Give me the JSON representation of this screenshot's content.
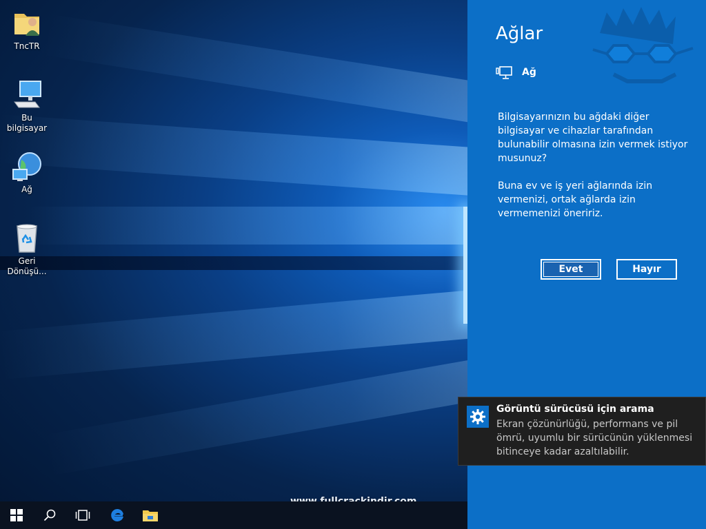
{
  "desktop": {
    "icons": [
      {
        "label": "TncTR",
        "icon": "user-folder-icon"
      },
      {
        "label": "Bu bilgisayar",
        "icon": "computer-icon"
      },
      {
        "label": "Ağ",
        "icon": "network-globe-icon"
      },
      {
        "label": "Geri Dönüşü...",
        "icon": "recycle-bin-icon"
      }
    ],
    "watermark": "www.fullcrackindir.com"
  },
  "taskbar": {
    "buttons": [
      "start-windows-icon",
      "search-icon",
      "task-view-icon",
      "edge-browser-icon",
      "file-explorer-icon"
    ]
  },
  "panel": {
    "title": "Ağlar",
    "network_name": "Ağ",
    "question": "Bilgisayarınızın bu ağdaki diğer bilgisayar ve cihazlar tarafından bulunabilir olmasına izin vermek istiyor musunuz?",
    "advice": "Buna ev ve iş yeri ağlarında izin vermenizi, ortak ağlarda izin vermemenizi öneririz.",
    "yes_label": "Evet",
    "no_label": "Hayır",
    "accent": "#0c6fc7"
  },
  "toast": {
    "title": "Görüntü sürücüsü için arama",
    "body": "Ekran çözünürlüğü, performans ve pil ömrü, uyumlu bir sürücünün yüklenmesi bitinceye kadar azaltılabilir.",
    "icon": "gear-icon"
  }
}
